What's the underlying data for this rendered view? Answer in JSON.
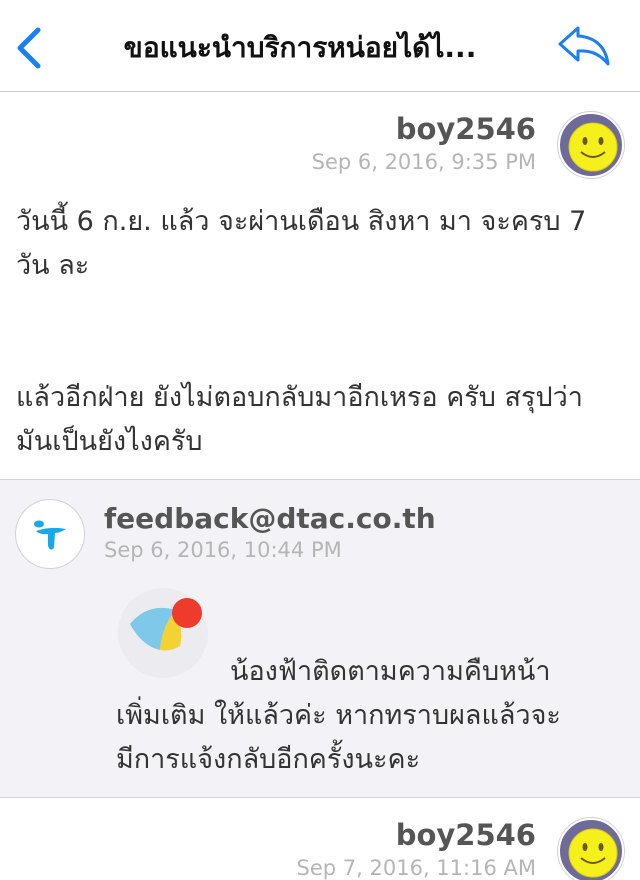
{
  "navbar": {
    "title": "ขอแนะนำบริการหน่อยได้ไ...",
    "back_icon": "chevron-left-icon",
    "reply_icon": "reply-arrow-icon",
    "accent_color": "#1a7ef5"
  },
  "messages": [
    {
      "sender": "boy2546",
      "date": "Sep 6, 2016, 9:35 PM",
      "avatar": "smiley-face-icon",
      "paragraphs": [
        "วันนี้ 6 ก.ย. แล้ว จะผ่านเดือน สิงหา มา จะครบ 7 วัน ละ",
        "แล้วอีกฝ่าย ยังไม่ตอบกลับมาอีกเหรอ ครับ สรุปว่ามันเป็นยังไงครับ"
      ]
    },
    {
      "sender": "feedback@dtac.co.th",
      "date": "Sep 6, 2016, 10:44 PM",
      "avatar": "dtac-logo-icon",
      "logo": "nongfa-logo-icon",
      "lines": [
        "น้องฟ้าติดตามความคืบหน้า",
        "เพิ่มเติม ให้แล้วค่ะ  หากทราบผลแล้วจะ",
        "มีการแจ้งกลับอีกครั้งนะคะ"
      ]
    },
    {
      "sender": "boy2546",
      "date": "Sep 7, 2016, 11:16 AM",
      "avatar": "smiley-face-icon"
    }
  ]
}
